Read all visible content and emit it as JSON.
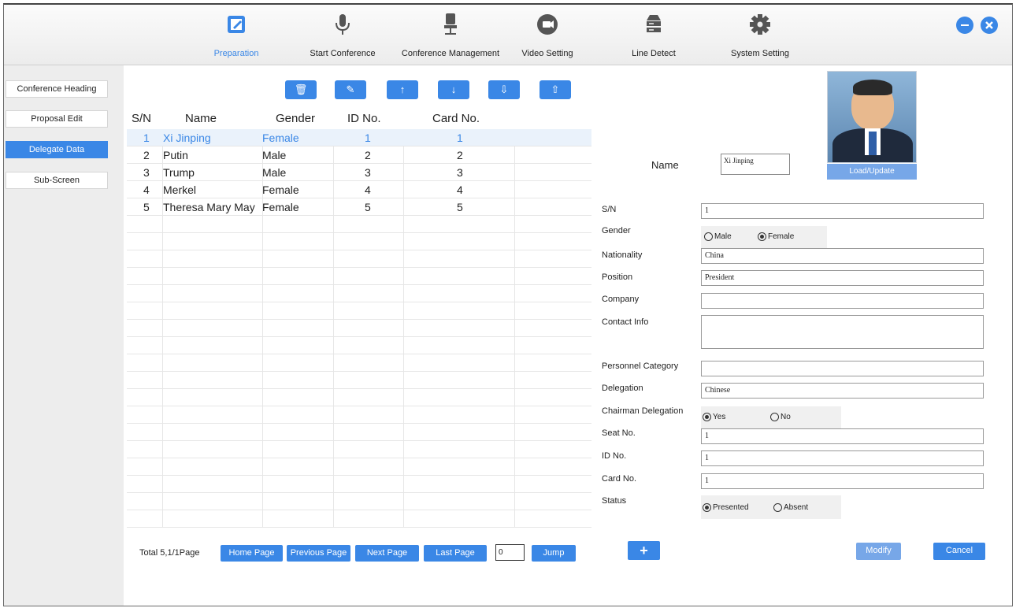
{
  "toolbar": {
    "items": [
      {
        "label": "Preparation",
        "icon": "edit-icon"
      },
      {
        "label": "Start Conference",
        "icon": "microphone-icon"
      },
      {
        "label": "Conference Management",
        "icon": "chair-icon"
      },
      {
        "label": "Video Setting",
        "icon": "video-icon"
      },
      {
        "label": "Line Detect",
        "icon": "server-icon"
      },
      {
        "label": "System Setting",
        "icon": "gear-icon"
      }
    ],
    "active": "Preparation",
    "accent": "#3a87e6"
  },
  "sidebar": {
    "items": [
      {
        "label": "Conference Heading"
      },
      {
        "label": "Proposal Edit"
      },
      {
        "label": "Delegate Data"
      },
      {
        "label": "Sub-Screen"
      }
    ],
    "active": "Delegate Data"
  },
  "actions": [
    "delete-icon",
    "clear-icon",
    "move-up-icon",
    "move-down-icon",
    "import-icon",
    "export-icon"
  ],
  "table": {
    "columns": [
      "S/N",
      "Name",
      "Gender",
      "ID No.",
      "Card No."
    ],
    "rows": [
      [
        "1",
        "Xi Jinping",
        "Female",
        "1",
        "1"
      ],
      [
        "2",
        "Putin",
        "Male",
        "2",
        "2"
      ],
      [
        "3",
        "Trump",
        "Male",
        "3",
        "3"
      ],
      [
        "4",
        "Merkel",
        "Female",
        "4",
        "4"
      ],
      [
        "5",
        "Theresa Mary May",
        "Female",
        "5",
        "5"
      ]
    ]
  },
  "pager": {
    "total": "Total 5,1/1Page",
    "home": "Home Page",
    "prev": "Previous Page",
    "next": "Next Page",
    "last": "Last Page",
    "page_value": "0",
    "jump": "Jump"
  },
  "form": {
    "name_label": "Name",
    "name_value": "Xi Jinping",
    "photo_button": "Load/Update",
    "sn_label": "S/N",
    "sn_value": "1",
    "gender_label": "Gender",
    "gender_male": "Male",
    "gender_female": "Female",
    "gender_selected": "Female",
    "nationality_label": "Nationality",
    "nationality_value": "China",
    "position_label": "Position",
    "position_value": "President",
    "company_label": "Company",
    "company_value": "",
    "contact_label": "Contact Info",
    "contact_value": "",
    "category_label": "Personnel Category",
    "category_value": "",
    "delegation_label": "Delegation",
    "delegation_value": "Chinese",
    "chairman_label": "Chairman Delegation",
    "chairman_yes": "Yes",
    "chairman_no": "No",
    "chairman_selected": "Yes",
    "seat_label": "Seat No.",
    "seat_value": "1",
    "id_label": "ID No.",
    "id_value": "1",
    "card_label": "Card No.",
    "card_value": "1",
    "status_label": "Status",
    "status_presented": "Presented",
    "status_absent": "Absent",
    "status_selected": "Presented",
    "add": "+",
    "modify": "Modify",
    "cancel": "Cancel"
  }
}
